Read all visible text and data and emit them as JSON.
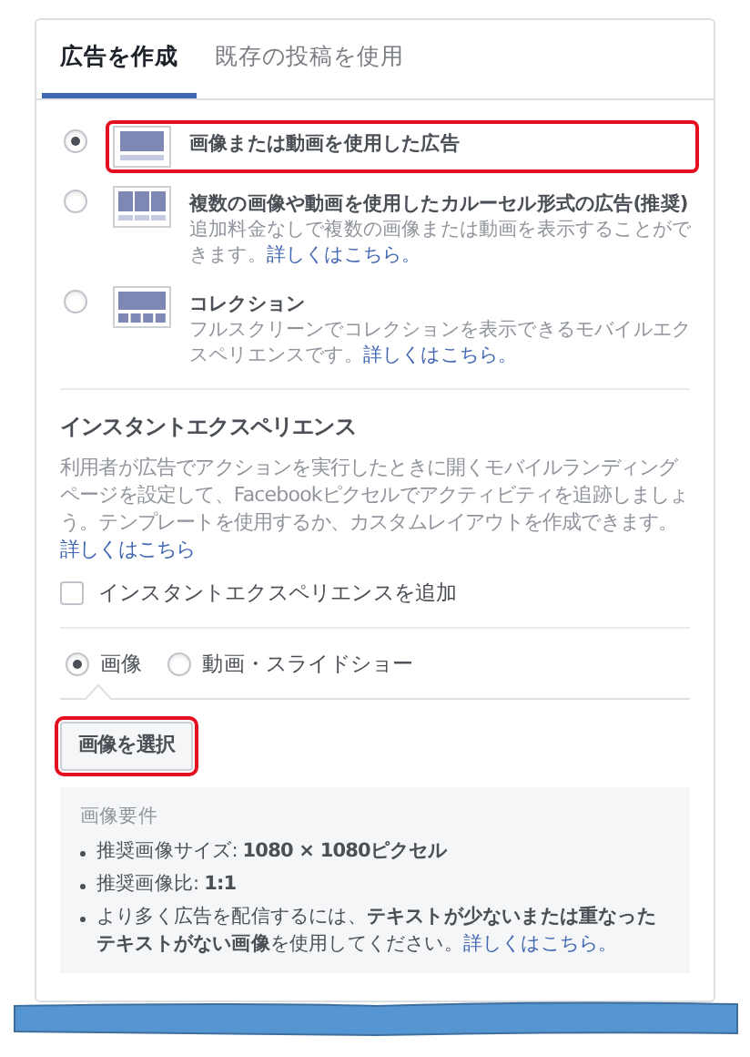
{
  "tabs": [
    {
      "label": "広告を作成",
      "selected": true
    },
    {
      "label": "既存の投稿を使用",
      "selected": false
    }
  ],
  "formats": [
    {
      "kind": "single",
      "title": "画像または動画を使用した広告",
      "selected": true,
      "highlighted": true
    },
    {
      "kind": "carousel",
      "title": "複数の画像や動画を使用したカルーセル形式の広告(推奨)",
      "description": "追加料金なしで複数の画像または動画を表示することができます。",
      "link": "詳しくはこちら。",
      "selected": false,
      "highlighted": false
    },
    {
      "kind": "collection",
      "title": "コレクション",
      "description": "フルスクリーンでコレクションを表示できるモバイルエクスペリエンスです。",
      "link": "詳しくはこちら。",
      "selected": false,
      "highlighted": false
    }
  ],
  "instant_experience": {
    "heading": "インスタントエクスペリエンス",
    "description": "利用者が広告でアクションを実行したときに開くモバイルランディングページを設定して、Facebookピクセルでアクティビティを追跡しましょう。テンプレートを使用するか、カスタムレイアウトを作成できます。",
    "link": "詳しくはこちら",
    "checkbox": {
      "label": "インスタントエクスペリエンスを追加",
      "checked": false
    }
  },
  "media_types": [
    {
      "label": "画像",
      "selected": true
    },
    {
      "label": "動画・スライドショー",
      "selected": false
    }
  ],
  "select_button": {
    "label": "画像を選択",
    "highlighted": true
  },
  "requirements": {
    "heading": "画像要件",
    "items": [
      {
        "text": "推奨画像サイズ: **1080 × 1080ピクセル**"
      },
      {
        "text": "推奨画像比: **1:1**"
      },
      {
        "text": "より多く広告を配信するには、**テキストが少ないまたは重なったテキストがない画像**を使用してください。",
        "link": "詳しくはこちら。"
      }
    ]
  }
}
